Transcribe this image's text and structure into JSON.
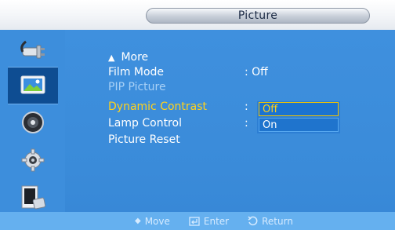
{
  "title": "Picture",
  "sidebar": {
    "items": [
      {
        "name": "input-icon"
      },
      {
        "name": "picture-icon",
        "active": true
      },
      {
        "name": "sound-icon"
      },
      {
        "name": "setup-icon"
      },
      {
        "name": "multi-control-icon"
      }
    ]
  },
  "menu": {
    "more_label": "More",
    "items": [
      {
        "label": "Film Mode",
        "value": ": Off",
        "state": "normal"
      },
      {
        "label": "PIP Picture",
        "value": "",
        "state": "disabled"
      },
      {
        "label": "Dynamic Contrast",
        "value": ":",
        "state": "selected"
      },
      {
        "label": "Lamp Control",
        "value": ":",
        "state": "normal"
      },
      {
        "label": "Picture Reset",
        "value": "",
        "state": "normal"
      }
    ]
  },
  "dropdown": {
    "options": [
      "Off",
      "On"
    ],
    "highlighted": "Off"
  },
  "help": {
    "move": "Move",
    "enter": "Enter",
    "return": "Return"
  },
  "colors": {
    "panel": "#3d8edc",
    "highlight_text": "#ffd21a",
    "disabled_text": "#a7d0f6"
  }
}
